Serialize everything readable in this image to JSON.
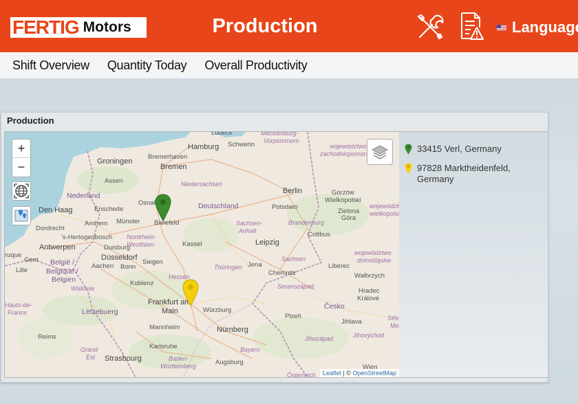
{
  "header": {
    "logo_brand": "FERTIG",
    "logo_model": "Motors",
    "title": "Production",
    "language_label": "Language",
    "icons": [
      "tools-icon",
      "report-warning-icon",
      "us-flag-icon"
    ],
    "background_color": "#e8461a"
  },
  "nav": {
    "items": [
      {
        "label": "Shift Overview"
      },
      {
        "label": "Quantity Today"
      },
      {
        "label": "Overall Productivity"
      }
    ]
  },
  "panel": {
    "title": "Production",
    "map": {
      "zoom_in": "+",
      "zoom_out": "−",
      "attribution_leaflet": "Leaflet",
      "attribution_sep": " | © ",
      "attribution_osm": "OpenStreetMap",
      "labels": {
        "lubeck": "Lübeck",
        "mecklenburg": "Mecklenburg-",
        "vorpommern": "Vorpommern",
        "woj1": "województwo",
        "woj1b": "zachodniopomorsk",
        "hamburg": "Hamburg",
        "schwerin": "Schwerin",
        "groningen": "Groningen",
        "bremerhaven": "Bremerhaven",
        "bremen": "Bremen",
        "assen": "Assen",
        "niedersachsen": "Niedersachsen",
        "berlin": "Berlin",
        "gorzow": "Gorzów",
        "wielkopolski": "Wielkopolski",
        "nederland": "Nederland",
        "osnabruck": "Osnabrück",
        "deutschland": "Deutschland",
        "potsdam": "Potsdam",
        "zielona": "Zielona",
        "gora": "Góra",
        "woj2": "województwo",
        "woj2b": "wielkopolskie",
        "denhaag": "Den Haag",
        "enschede": "Enschede",
        "arnhem": "Arnhem",
        "munster": "Münster",
        "bielefeld": "Bielefeld",
        "sachsen_anhalt": "Sachsen-",
        "anhalt": "Anhalt",
        "brandenburg": "Brandenburg",
        "dordrecht": "Dordrecht",
        "shertogenbosch": "'s-Hertogenbosch",
        "nordrhein": "Nordrhein-",
        "westfalen": "Westfalen",
        "kassel": "Kassel",
        "leipzig": "Leipzig",
        "cottbus": "Cottbus",
        "antwerpen": "Antwerpen",
        "duisburg": "Duisburg",
        "woj3": "województwo",
        "woj3b": "dolnośląskie",
        "ruque": "ruque",
        "gent": "Gent",
        "dusseldorf": "Düsseldorf",
        "sachsen": "Sachsen",
        "belgie": "België /",
        "aachen": "Aachen",
        "bonn": "Bonn",
        "siegen": "Siegen",
        "thuringen": "Thüringen",
        "jena": "Jena",
        "liberec": "Liberec",
        "lille": "Lille",
        "belgique": "Belgique /",
        "belgien": "Belgien",
        "hessen": "Hessen",
        "chemnitz": "Chemnitz",
        "walbrzych": "Wałbrzych",
        "wallonie": "Wallonie",
        "koblenz": "Koblenz",
        "severozapad": "Severozápad",
        "hradec": "Hradec",
        "kralove": "Králové",
        "hauts": "Hauts-de-",
        "france": "France",
        "letzebuerg": "Lëtzebuerg",
        "frankfurt": "Frankfurt am",
        "main": "Main",
        "wurzburg": "Würzburg",
        "cesko": "Česko",
        "plzen": "Plzeň",
        "jihlava": "Jihlava",
        "stre": "Stře",
        "mor": "Mor",
        "mannheim": "Mannheim",
        "nurnberg": "Nürnberg",
        "jihozapad": "Jihozápad",
        "jihovychod": "Jihovýchod",
        "reims": "Reims",
        "karlsruhe": "Karlsruhe",
        "bayern": "Bayern",
        "grand": "Grand",
        "est": "Est",
        "strasbourg": "Strasbourg",
        "baden": "Baden-",
        "wurttemberg": "Württemberg",
        "augsburg": "Augsburg",
        "wien": "Wien",
        "osterreich": "Österreich"
      }
    },
    "legend": [
      {
        "address": "33415 Verl, Germany",
        "color": "#2e8b2e",
        "marker": "green-pin-icon"
      },
      {
        "address": "97828 Marktheidenfeld, Germany",
        "color": "#f2cc0c",
        "marker": "yellow-pin-icon"
      }
    ]
  }
}
